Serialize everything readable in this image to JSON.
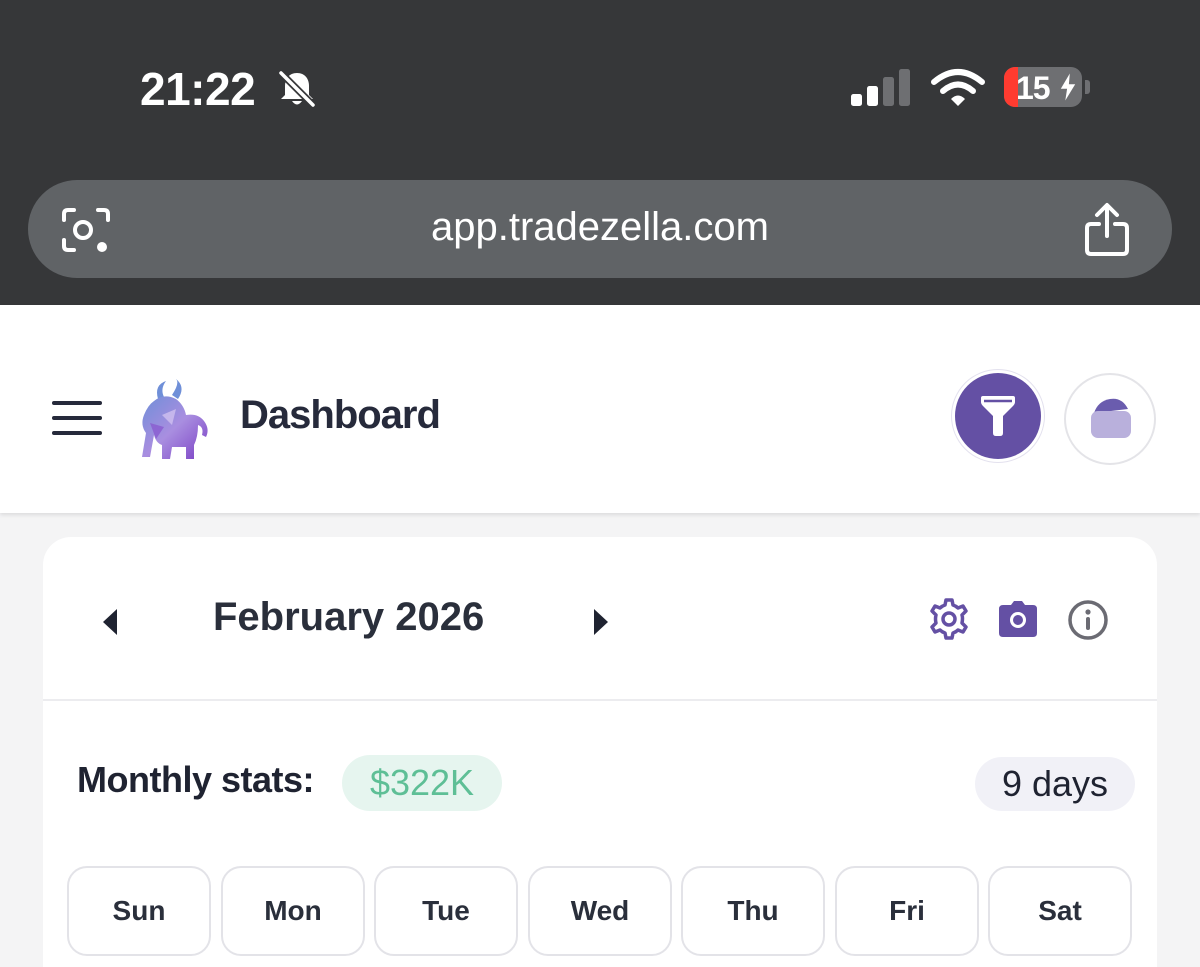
{
  "status_bar": {
    "time": "21:22",
    "battery_level": "15",
    "icons": [
      "bell-slash-icon",
      "cellular-signal-icon",
      "wifi-icon",
      "battery-charging-icon"
    ]
  },
  "browser": {
    "url": "app.tradezella.com",
    "icons": [
      "visual-lookup-icon",
      "share-icon"
    ]
  },
  "header": {
    "title": "Dashboard",
    "icons": [
      "hamburger-menu-icon",
      "bull-logo",
      "filter-icon",
      "wallet-icon"
    ],
    "accent_color": "#6450a4"
  },
  "calendar": {
    "month_title": "February 2026",
    "icons": [
      "chevron-left-icon",
      "chevron-right-icon",
      "gear-icon",
      "camera-icon",
      "info-icon"
    ],
    "stats_label": "Monthly stats:",
    "stats_value": "$322K",
    "stats_value_color": "#5ebf96",
    "days_label": "9 days",
    "weekdays": [
      "Sun",
      "Mon",
      "Tue",
      "Wed",
      "Thu",
      "Fri",
      "Sat"
    ]
  }
}
